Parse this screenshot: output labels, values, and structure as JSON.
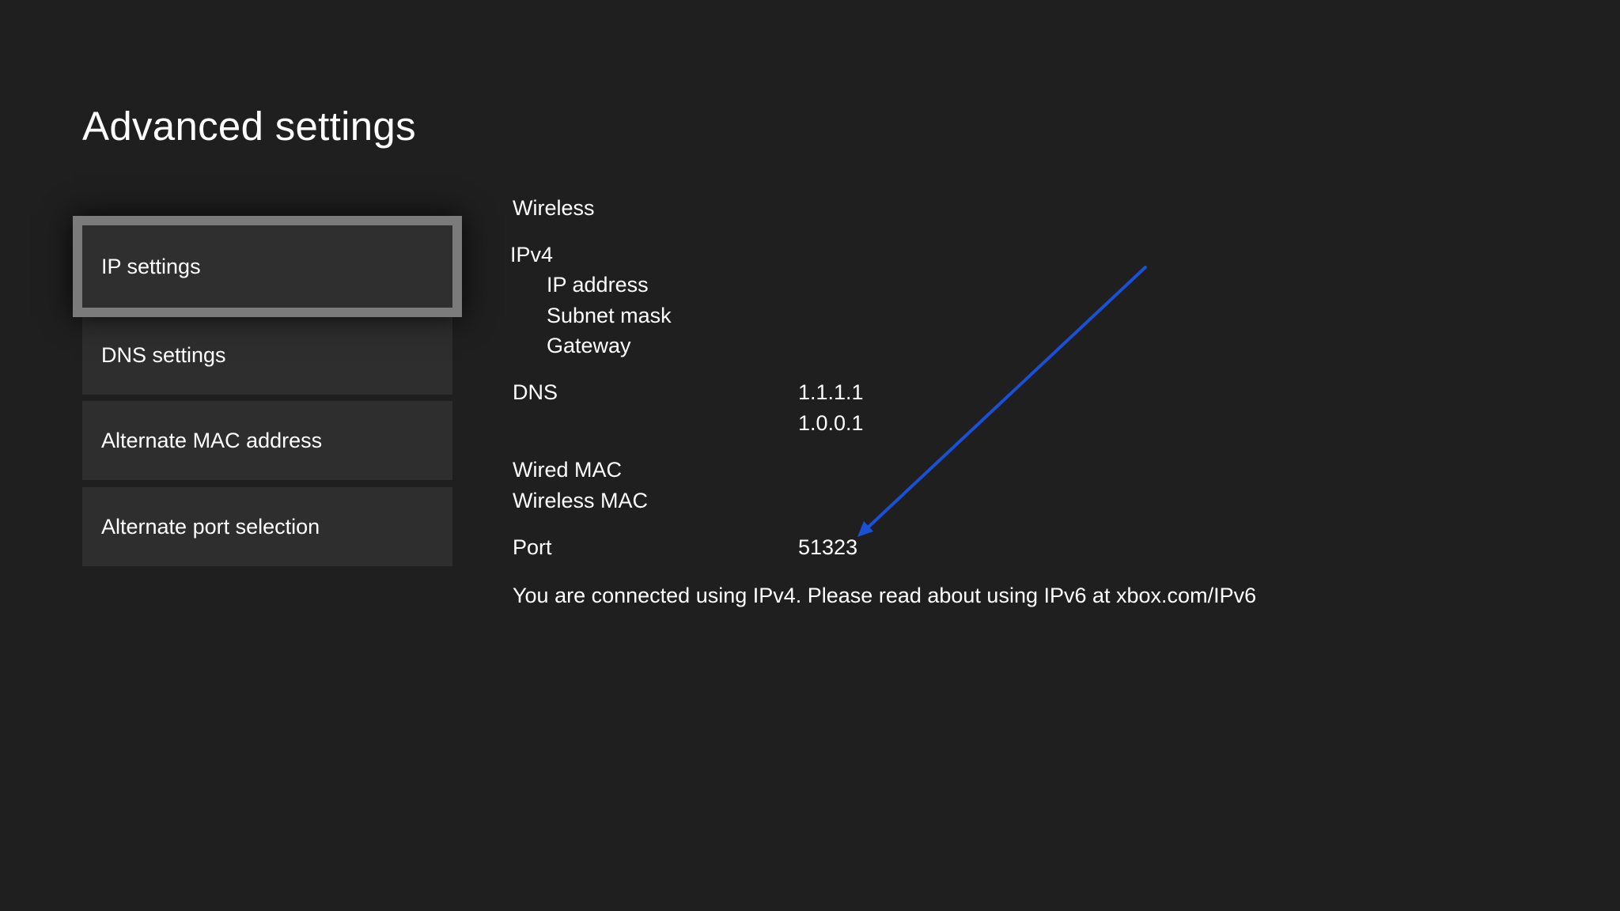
{
  "title": "Advanced settings",
  "menu": {
    "items": [
      {
        "label": "IP settings"
      },
      {
        "label": "DNS settings"
      },
      {
        "label": "Alternate MAC address"
      },
      {
        "label": "Alternate port selection"
      }
    ]
  },
  "details": {
    "connection_type": "Wireless",
    "ipv4_label": "IPv4",
    "ip_address_label": "IP address",
    "subnet_mask_label": "Subnet mask",
    "gateway_label": "Gateway",
    "dns_label": "DNS",
    "dns_primary": "1.1.1.1",
    "dns_secondary": "1.0.0.1",
    "wired_mac_label": "Wired MAC",
    "wireless_mac_label": "Wireless MAC",
    "port_label": "Port",
    "port_value": "51323",
    "ipv6_notice": "You are connected using IPv4. Please read about using IPv6 at xbox.com/IPv6"
  },
  "colors": {
    "background": "#1f1f1f",
    "menu_item": "#2e2e2e",
    "focus_border": "#7b7b7b",
    "annotation_arrow": "#1a4fd6"
  }
}
